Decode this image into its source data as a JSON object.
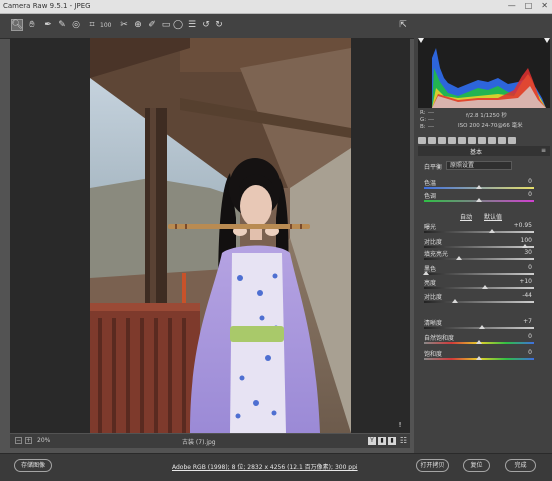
{
  "window": {
    "title": "Camera Raw 9.5.1  -  JPEG"
  },
  "toolbar": {
    "zoom_label": "100"
  },
  "histogram_info": {
    "r": "R:",
    "g": "G:",
    "b": "B:",
    "rgb_dash_r": "---",
    "rgb_dash_g": "---",
    "rgb_dash_b": "---",
    "exposure": "f/2.8   1/1250 秒",
    "iso": "ISO 200   24-70@66 毫米"
  },
  "panel": {
    "section_title": "基本",
    "white_balance_label": "白平衡",
    "white_balance_value": "原照设置",
    "auto_link": "自动",
    "default_link": "默认值",
    "sliders": [
      {
        "label": "色温",
        "value": "0",
        "pos": 0.5,
        "track": "temp"
      },
      {
        "label": "色调",
        "value": "0",
        "pos": 0.5,
        "track": "tint"
      },
      {
        "label": "曝光",
        "value": "+0.95",
        "pos": 0.62,
        "track": "gray"
      },
      {
        "label": "对比度",
        "value": "100",
        "pos": 0.92,
        "track": "gray"
      },
      {
        "label": "填充亮光",
        "value": "30",
        "pos": 0.32,
        "track": "gray"
      },
      {
        "label": "黑色",
        "value": "0",
        "pos": 0.02,
        "track": "gray"
      },
      {
        "label": "亮度",
        "value": "+10",
        "pos": 0.55,
        "track": "gray"
      },
      {
        "label": "对比度",
        "value": "-44",
        "pos": 0.28,
        "track": "gray"
      },
      {
        "label": "清晰度",
        "value": "+7",
        "pos": 0.53,
        "track": "gray"
      },
      {
        "label": "自然饱和度",
        "value": "0",
        "pos": 0.5,
        "track": "vib"
      },
      {
        "label": "饱和度",
        "value": "0",
        "pos": 0.5,
        "track": "sat"
      }
    ]
  },
  "image_bar": {
    "zoom_value": "20%",
    "filename": "古装 (7).jpg",
    "buttons": [
      "Y",
      "▮",
      "▮"
    ]
  },
  "bottom": {
    "save_button": "存储图像",
    "workflow_link": "Adobe RGB (1998); 8 位; 2832 x 4256 (12.1 百万像素); 300 ppi",
    "open_copy_button": "打开拷贝",
    "reset_button": "复位",
    "done_button": "完成"
  },
  "colors": {
    "panel_bg": "#414141",
    "canvas_bg": "#292929",
    "accent": "#d9d9d9"
  }
}
